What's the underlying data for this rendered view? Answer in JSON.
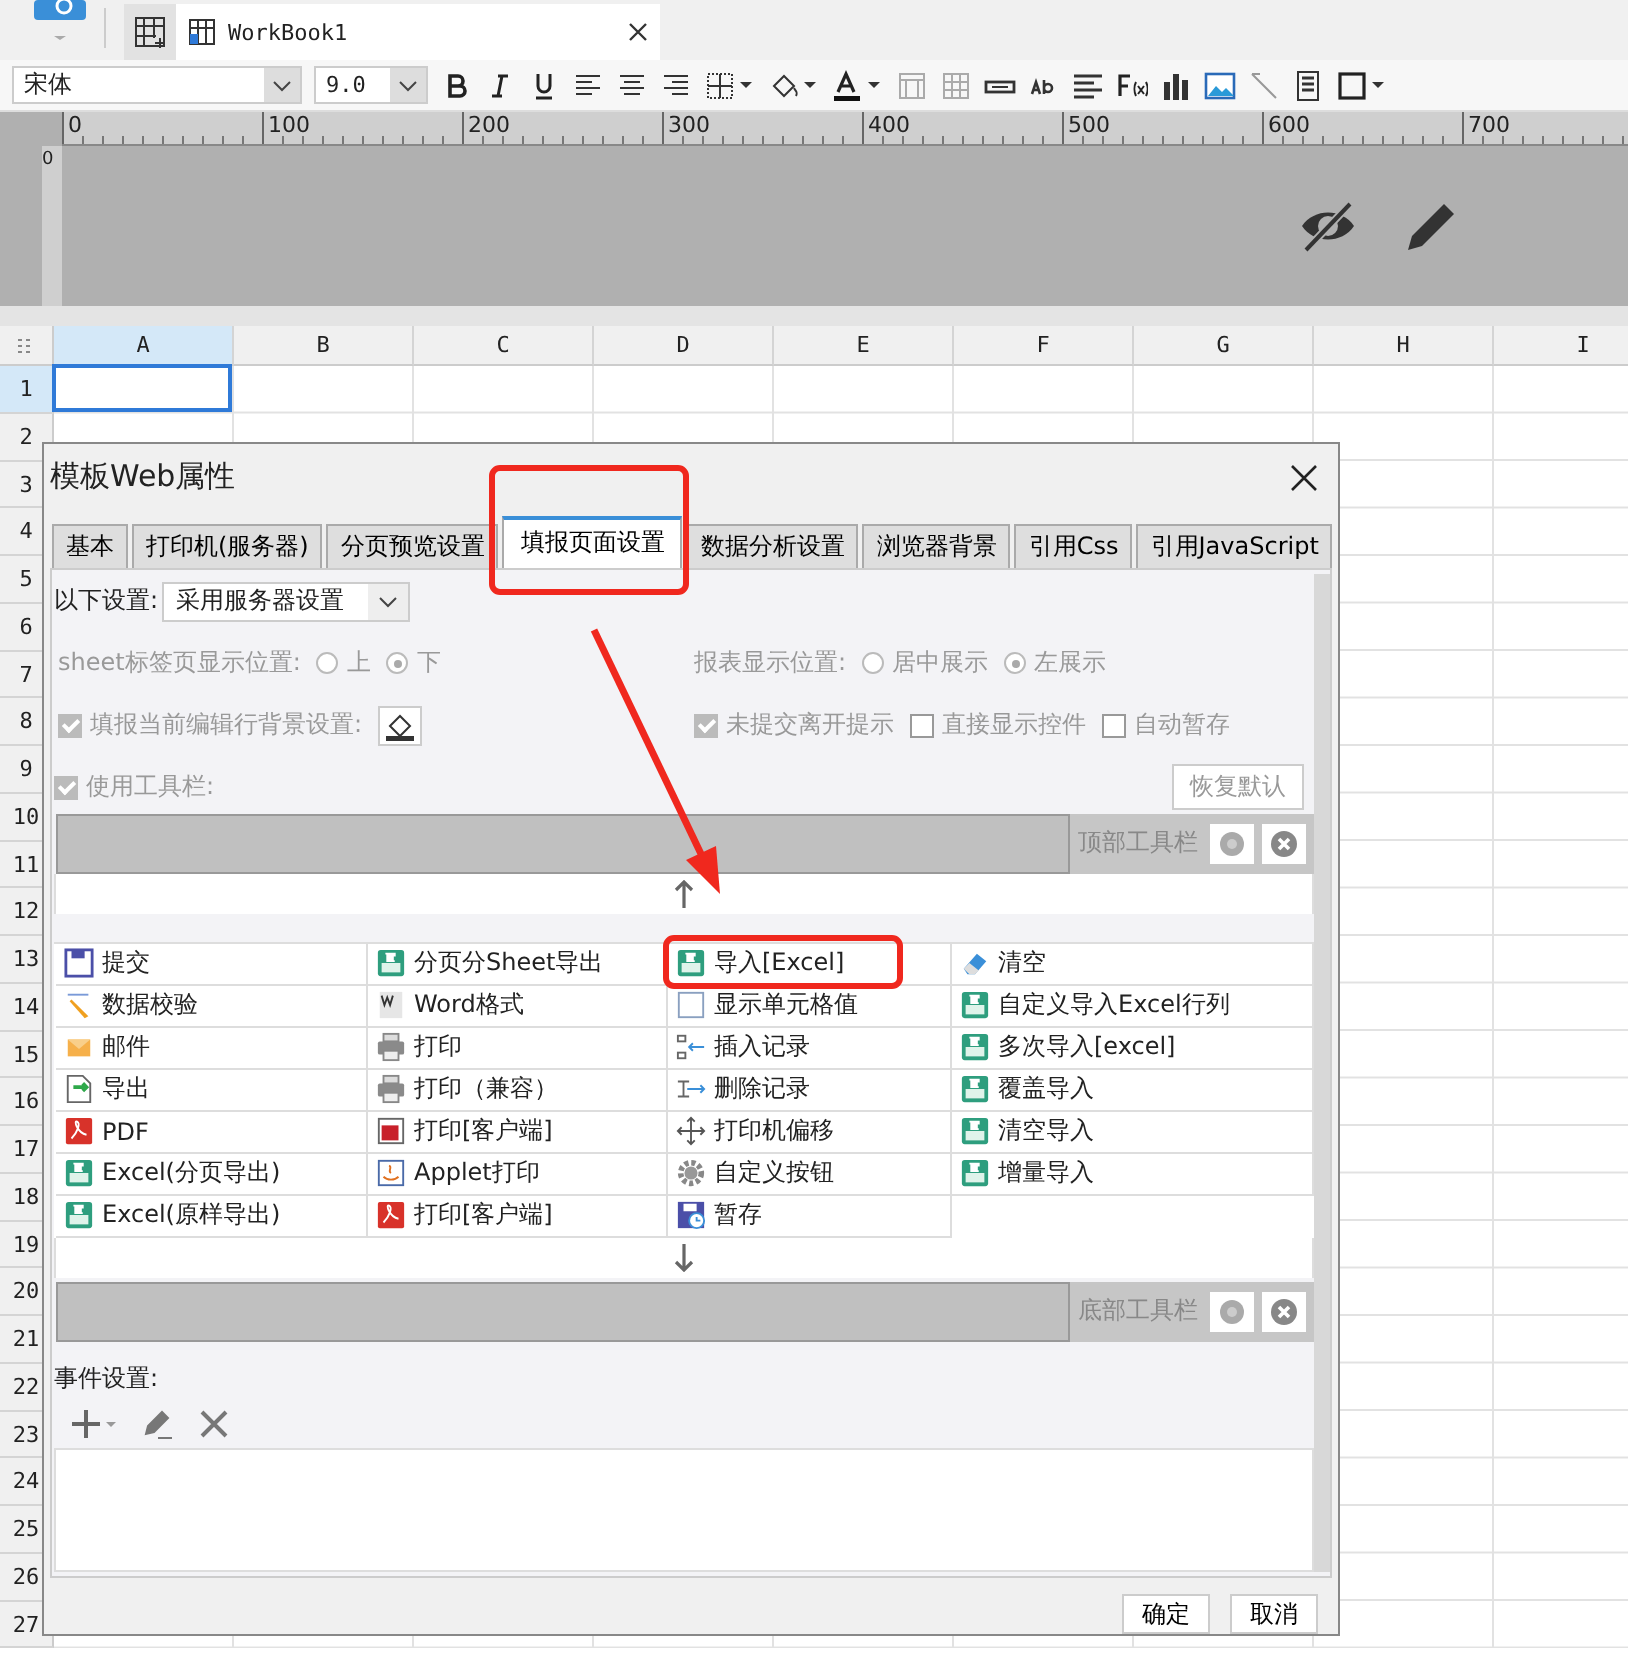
{
  "document_tabs": [
    {
      "label": "WorkBook1",
      "selected": true
    }
  ],
  "format_toolbar": {
    "font": "宋体",
    "size": "9.0"
  },
  "ruler": {
    "ticks": [
      "0",
      "100",
      "200",
      "300",
      "400",
      "500",
      "600",
      "700"
    ],
    "vertical_tick": "0"
  },
  "sheet": {
    "columns": [
      {
        "label": "A",
        "selected": true
      },
      {
        "label": "B",
        "selected": false
      },
      {
        "label": "C",
        "selected": false
      },
      {
        "label": "D",
        "selected": false
      },
      {
        "label": "E",
        "selected": false
      },
      {
        "label": "F",
        "selected": false
      },
      {
        "label": "G",
        "selected": false
      },
      {
        "label": "H",
        "selected": false
      },
      {
        "label": "I",
        "selected": false
      }
    ],
    "rows": [
      {
        "label": "1",
        "selected": true
      },
      {
        "label": "2",
        "selected": false
      },
      {
        "label": "3",
        "selected": false
      },
      {
        "label": "4",
        "selected": false
      },
      {
        "label": "5",
        "selected": false
      },
      {
        "label": "6",
        "selected": false
      },
      {
        "label": "7",
        "selected": false
      },
      {
        "label": "8",
        "selected": false
      },
      {
        "label": "9",
        "selected": false
      },
      {
        "label": "10",
        "selected": false
      },
      {
        "label": "11",
        "selected": false
      },
      {
        "label": "12",
        "selected": false
      },
      {
        "label": "13",
        "selected": false
      },
      {
        "label": "14",
        "selected": false
      },
      {
        "label": "15",
        "selected": false
      },
      {
        "label": "16",
        "selected": false
      },
      {
        "label": "17",
        "selected": false
      },
      {
        "label": "18",
        "selected": false
      },
      {
        "label": "19",
        "selected": false
      },
      {
        "label": "20",
        "selected": false
      },
      {
        "label": "21",
        "selected": false
      },
      {
        "label": "22",
        "selected": false
      },
      {
        "label": "23",
        "selected": false
      },
      {
        "label": "24",
        "selected": false
      },
      {
        "label": "25",
        "selected": false
      },
      {
        "label": "26",
        "selected": false
      },
      {
        "label": "27",
        "selected": false
      }
    ]
  },
  "dialog": {
    "title": "模板Web属性",
    "tabs": [
      {
        "label": "基本",
        "selected": false
      },
      {
        "label": "打印机(服务器)",
        "selected": false
      },
      {
        "label": "分页预览设置",
        "selected": false
      },
      {
        "label": "填报页面设置",
        "selected": true
      },
      {
        "label": "数据分析设置",
        "selected": false
      },
      {
        "label": "浏览器背景",
        "selected": false
      },
      {
        "label": "引用Css",
        "selected": false
      },
      {
        "label": "引用JavaScript",
        "selected": false
      }
    ],
    "settings_source": {
      "label": "以下设置:",
      "value": "采用服务器设置"
    },
    "sheet_tab_position": {
      "label": "sheet标签页显示位置:",
      "disabled": true,
      "options": [
        {
          "label": "上",
          "selected": false
        },
        {
          "label": "下",
          "selected": true
        }
      ]
    },
    "report_position": {
      "label": "报表显示位置:",
      "disabled": true,
      "options": [
        {
          "label": "居中展示",
          "selected": false
        },
        {
          "label": "左展示",
          "selected": true
        }
      ]
    },
    "edit_row_background": {
      "label": "填报当前编辑行背景设置:",
      "checked": true,
      "disabled": true
    },
    "options": [
      {
        "label": "未提交离开提示",
        "checked": true,
        "disabled": true
      },
      {
        "label": "直接显示控件",
        "checked": false,
        "disabled": true
      },
      {
        "label": "自动暂存",
        "checked": false,
        "disabled": true
      }
    ],
    "use_toolbar": {
      "label": "使用工具栏:",
      "checked": true,
      "disabled": true
    },
    "restore_button": "恢复默认",
    "top_toolbar": "顶部工具栏",
    "toolbar_buttons": [
      {
        "label": "提交",
        "kind": "save"
      },
      {
        "label": "分页分Sheet导出",
        "kind": "excel"
      },
      {
        "label": "导入[Excel]",
        "kind": "excel"
      },
      {
        "label": "清空",
        "kind": "eraser"
      },
      {
        "label": "数据校验",
        "kind": "check"
      },
      {
        "label": "Word格式",
        "kind": "word"
      },
      {
        "label": "显示单元格值",
        "kind": "blank"
      },
      {
        "label": "自定义导入Excel行列",
        "kind": "excel"
      },
      {
        "label": "邮件",
        "kind": "mail"
      },
      {
        "label": "打印",
        "kind": "print"
      },
      {
        "label": "插入记录",
        "kind": "insert"
      },
      {
        "label": "多次导入[excel]",
        "kind": "excel"
      },
      {
        "label": "导出",
        "kind": "export"
      },
      {
        "label": "打印（兼容）",
        "kind": "print"
      },
      {
        "label": "删除记录",
        "kind": "delete"
      },
      {
        "label": "覆盖导入",
        "kind": "excel"
      },
      {
        "label": "PDF",
        "kind": "pdf"
      },
      {
        "label": "打印[客户端]",
        "kind": "flash"
      },
      {
        "label": "打印机偏移",
        "kind": "move"
      },
      {
        "label": "清空导入",
        "kind": "excel"
      },
      {
        "label": "Excel(分页导出)",
        "kind": "excel"
      },
      {
        "label": "Applet打印",
        "kind": "applet"
      },
      {
        "label": "自定义按钮",
        "kind": "gear"
      },
      {
        "label": "增量导入",
        "kind": "excel"
      },
      {
        "label": "Excel(原样导出)",
        "kind": "excel"
      },
      {
        "label": "打印[客户端]",
        "kind": "pdf"
      },
      {
        "label": "暂存",
        "kind": "timer"
      }
    ],
    "bottom_toolbar": "底部工具栏",
    "events_label": "事件设置:",
    "ok_button": "确定",
    "cancel_button": "取消"
  }
}
